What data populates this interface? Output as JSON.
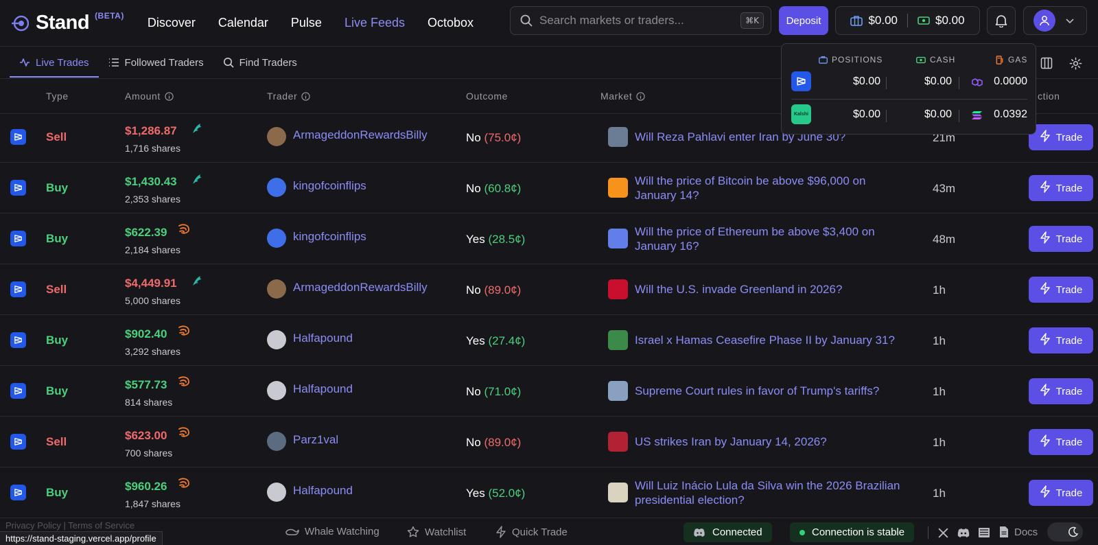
{
  "brand": {
    "name": "Stand",
    "beta": "(BETA)"
  },
  "nav": [
    {
      "label": "Discover"
    },
    {
      "label": "Calendar"
    },
    {
      "label": "Pulse"
    },
    {
      "label": "Live Feeds",
      "active": true
    },
    {
      "label": "Octobox"
    }
  ],
  "search": {
    "placeholder": "Search markets or traders...",
    "shortcut": "⌘K"
  },
  "header": {
    "deposit_label": "Deposit",
    "positions_balance": "$0.00",
    "cash_balance": "$0.00"
  },
  "subtabs": [
    {
      "label": "Live Trades",
      "active": true
    },
    {
      "label": "Followed Traders"
    },
    {
      "label": "Find Traders"
    }
  ],
  "table": {
    "headers": {
      "type": "Type",
      "amount": "Amount",
      "trader": "Trader",
      "outcome": "Outcome",
      "market": "Market",
      "action": "ction"
    },
    "rows": [
      {
        "type": "Sell",
        "amount": "$1,286.87",
        "shares": "1,716 shares",
        "badge": "dolphin-icon",
        "trader": "ArmageddonRewardsBilly",
        "outcome": "No",
        "price": "(75.0¢)",
        "market": "Will Reza Pahlavi enter Iran by June 30?",
        "market_line2": "",
        "age": "21m",
        "trade": "Trade"
      },
      {
        "type": "Buy",
        "amount": "$1,430.43",
        "shares": "2,353 shares",
        "badge": "dolphin-icon",
        "trader": "kingofcoinflips",
        "outcome": "No",
        "price": "(60.8¢)",
        "market": "Will the price of Bitcoin be above $96,000 on",
        "market_line2": "January 14?",
        "age": "43m",
        "trade": "Trade"
      },
      {
        "type": "Buy",
        "amount": "$622.39",
        "shares": "2,184 shares",
        "badge": "shrimp-icon",
        "trader": "kingofcoinflips",
        "outcome": "Yes",
        "price": "(28.5¢)",
        "market": "Will the price of Ethereum be above $3,400 on",
        "market_line2": "January 16?",
        "age": "48m",
        "trade": "Trade"
      },
      {
        "type": "Sell",
        "amount": "$4,449.91",
        "shares": "5,000 shares",
        "badge": "dolphin-icon",
        "trader": "ArmageddonRewardsBilly",
        "outcome": "No",
        "price": "(89.0¢)",
        "market": "Will the U.S. invade Greenland in 2026?",
        "market_line2": "",
        "age": "1h",
        "trade": "Trade"
      },
      {
        "type": "Buy",
        "amount": "$902.40",
        "shares": "3,292 shares",
        "badge": "shrimp-icon",
        "trader": "Halfapound",
        "outcome": "Yes",
        "price": "(27.4¢)",
        "market": "Israel x Hamas Ceasefire Phase II by January 31?",
        "market_line2": "",
        "age": "1h",
        "trade": "Trade"
      },
      {
        "type": "Buy",
        "amount": "$577.73",
        "shares": "814 shares",
        "badge": "shrimp-icon",
        "trader": "Halfapound",
        "outcome": "No",
        "price": "(71.0¢)",
        "market": "Supreme Court rules in favor of Trump's tariffs?",
        "market_line2": "",
        "age": "1h",
        "trade": "Trade"
      },
      {
        "type": "Sell",
        "amount": "$623.00",
        "shares": "700 shares",
        "badge": "shrimp-icon",
        "trader": "Parz1val",
        "outcome": "No",
        "price": "(89.0¢)",
        "market": "US strikes Iran by January 14, 2026?",
        "market_line2": "",
        "age": "1h",
        "trade": "Trade"
      },
      {
        "type": "Buy",
        "amount": "$960.26",
        "shares": "1,847 shares",
        "badge": "shrimp-icon",
        "trader": "Halfapound",
        "outcome": "Yes",
        "price": "(52.0¢)",
        "market": "Will Luiz Inácio Lula da Silva win the 2026 Brazilian",
        "market_line2": "presidential election?",
        "age": "1h",
        "trade": "Trade"
      }
    ]
  },
  "popover": {
    "headers": {
      "positions": "POSITIONS",
      "cash": "CASH",
      "gas": "GAS"
    },
    "rows": [
      {
        "platform": "polymarket",
        "positions": "$0.00",
        "cash": "$0.00",
        "gas": "0.0000"
      },
      {
        "platform": "kalshi",
        "logo_text": "Kalshi",
        "positions": "$0.00",
        "cash": "$0.00",
        "gas": "0.0392"
      }
    ]
  },
  "footer": {
    "left_faded": "Privacy Policy  |  Terms of Service",
    "whale": "Whale Watching",
    "watchlist": "Watchlist",
    "quick_trade": "Quick Trade",
    "connected": "Connected",
    "stable": "Connection is stable",
    "docs": "Docs"
  },
  "status_url": "https://stand-staging.vercel.app/profile",
  "colors": {
    "accent": "#5b4fe6",
    "link": "#8b8cf5",
    "sell": "#ef6b6b",
    "buy": "#4cd07d",
    "bg": "#17171b"
  }
}
